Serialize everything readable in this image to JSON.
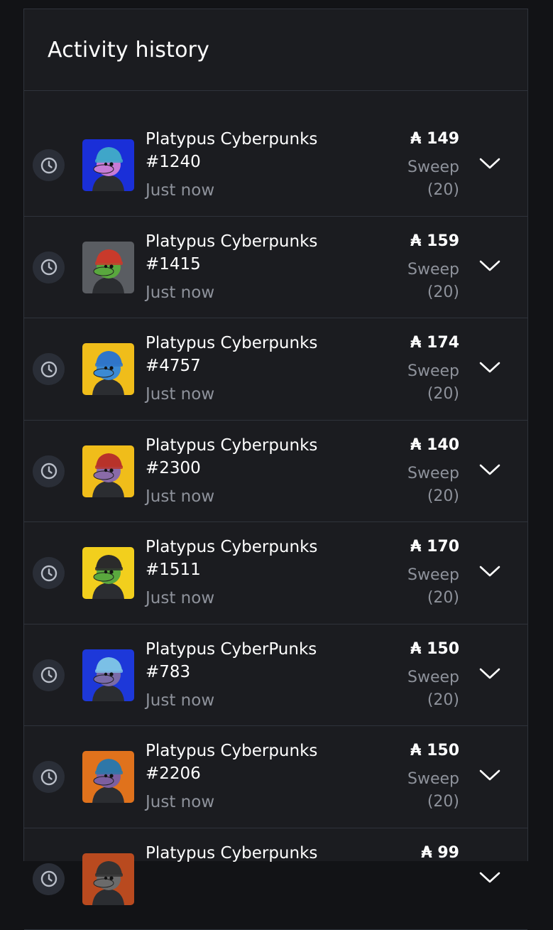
{
  "panel": {
    "title": "Activity history"
  },
  "currency_symbol": "₳",
  "activities": [
    {
      "name": "Platypus Cyberpunks",
      "number": "#1240",
      "time": "Just now",
      "price": "₳ 149",
      "type": "Sweep",
      "count": "(20)",
      "bg": "#1a2fd8",
      "hat": "#3fa6c9",
      "skin": "#c77bd6"
    },
    {
      "name": "Platypus Cyberpunks",
      "number": "#1415",
      "time": "Just now",
      "price": "₳ 159",
      "type": "Sweep",
      "count": "(20)",
      "bg": "#5a5d62",
      "hat": "#c93a2b",
      "skin": "#59a83e"
    },
    {
      "name": "Platypus Cyberpunks",
      "number": "#4757",
      "time": "Just now",
      "price": "₳ 174",
      "type": "Sweep",
      "count": "(20)",
      "bg": "#f0bd1a",
      "hat": "#2f75c9",
      "skin": "#3b8ad4"
    },
    {
      "name": "Platypus Cyberpunks",
      "number": "#2300",
      "time": "Just now",
      "price": "₳ 140",
      "type": "Sweep",
      "count": "(20)",
      "bg": "#f0bd1a",
      "hat": "#b8322a",
      "skin": "#8a6ba8"
    },
    {
      "name": "Platypus Cyberpunks",
      "number": "#1511",
      "time": "Just now",
      "price": "₳ 170",
      "type": "Sweep",
      "count": "(20)",
      "bg": "#f2cf1d",
      "hat": "#2b2b2b",
      "skin": "#5aa83e"
    },
    {
      "name": "Platypus CyberPunks",
      "number": "#783",
      "time": "Just now",
      "price": "₳ 150",
      "type": "Sweep",
      "count": "(20)",
      "bg": "#1d38d9",
      "hat": "#7bc0e6",
      "skin": "#7a6ba8"
    },
    {
      "name": "Platypus Cyberpunks",
      "number": "#2206",
      "time": "Just now",
      "price": "₳ 150",
      "type": "Sweep",
      "count": "(20)",
      "bg": "#e0721c",
      "hat": "#2e77a8",
      "skin": "#7c5fa0"
    },
    {
      "name": "Platypus Cyberpunks",
      "number": "",
      "time": "",
      "price": "₳ 99",
      "type": "",
      "count": "",
      "bg": "#b94a1f",
      "hat": "#333333",
      "skin": "#6b6b6b"
    }
  ],
  "colors": {
    "background": "#121316",
    "panel": "#1b1c20",
    "border": "#2f333b",
    "text": "#ffffff",
    "muted": "#8e929b",
    "icon_circle": "#2a2e37"
  },
  "icons": {
    "status": "clock-icon",
    "expand": "chevron-down-icon"
  }
}
